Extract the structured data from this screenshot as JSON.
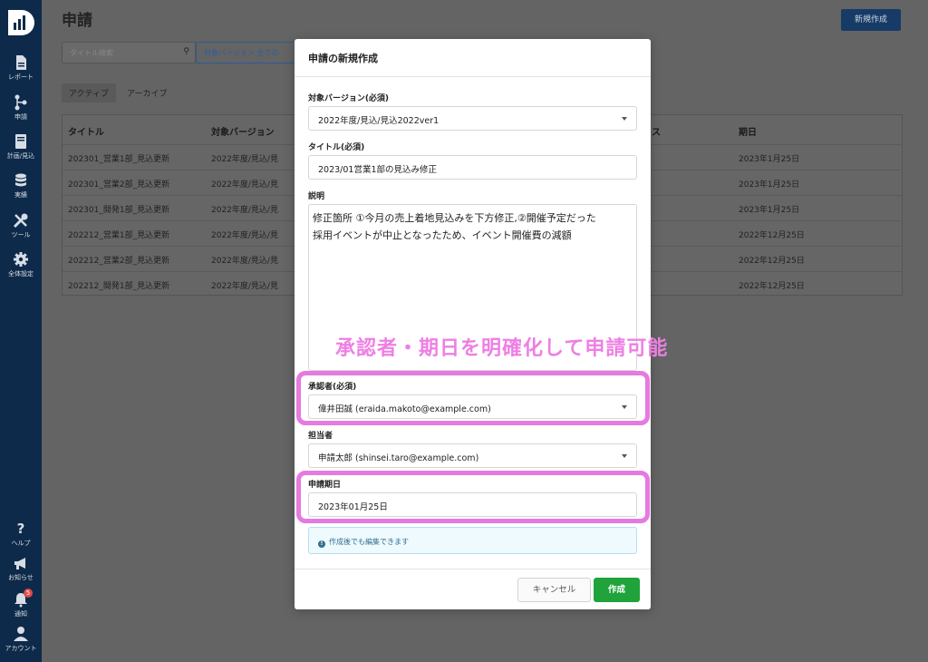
{
  "sidebar": {
    "items": [
      {
        "label": "レポート",
        "icon": "file-icon"
      },
      {
        "label": "申請",
        "icon": "flow-icon"
      },
      {
        "label": "計画/見込",
        "icon": "book-icon"
      },
      {
        "label": "実績",
        "icon": "database-icon"
      },
      {
        "label": "ツール",
        "icon": "tools-icon"
      },
      {
        "label": "全体設定",
        "icon": "gear-icon"
      }
    ],
    "bottom": [
      {
        "label": "ヘルプ",
        "icon": "help-icon"
      },
      {
        "label": "お知らせ",
        "icon": "megaphone-icon"
      },
      {
        "label": "通知",
        "icon": "bell-icon",
        "badge": "5"
      },
      {
        "label": "アカウント",
        "icon": "user-icon"
      }
    ]
  },
  "page": {
    "title": "申請",
    "new_button": "新規作成",
    "search_placeholder": "タイトル検索",
    "filter_label": "対象バージョン 全ての",
    "tabs": [
      "アクティブ",
      "アーカイブ"
    ]
  },
  "table": {
    "headers": [
      "タイトル",
      "対象バージョン",
      "ス",
      "期日"
    ],
    "rows": [
      [
        "202301_営業1部_見込更新",
        "2022年度/見込/見",
        "2023年1月25日"
      ],
      [
        "202301_営業2部_見込更新",
        "2022年度/見込/見",
        "2023年1月25日"
      ],
      [
        "202301_開発1部_見込更新",
        "2022年度/見込/見",
        "2023年1月25日"
      ],
      [
        "202212_営業1部_見込更新",
        "2022年度/見込/見",
        "2022年12月25日"
      ],
      [
        "202212_営業2部_見込更新",
        "2022年度/見込/見",
        "2022年12月25日"
      ],
      [
        "202212_開発1部_見込更新",
        "2022年度/見込/見",
        "2022年12月25日"
      ]
    ]
  },
  "modal": {
    "title": "申請の新規作成",
    "version_label": "対象バージョン(必須)",
    "version_value": "2022年度/見込/見込2022ver1",
    "title_label": "タイトル(必須)",
    "title_value": "2023/01営業1部の見込み修正",
    "desc_label": "説明",
    "desc_line1": "修正箇所 ①今月の売上着地見込みを下方修正,②開催予定だった",
    "desc_line2": "採用イベントが中止となったため、イベント開催費の減額",
    "approver_label": "承認者(必須)",
    "approver_value": "偉井田誠 (eraida.makoto@example.com)",
    "assignee_label": "担当者",
    "assignee_value": "申請太郎 (shinsei.taro@example.com)",
    "due_label": "申請期日",
    "due_value": "2023年01月25日",
    "info_text": "作成後でも編集できます",
    "cancel": "キャンセル",
    "create": "作成"
  },
  "annotation": {
    "callout": "承認者・期日を明確化して申請可能",
    "color": "#e57ae0"
  },
  "colors": {
    "sidebar": "#0e2a4a",
    "create_button": "#1fa33a",
    "info_bg": "#eefafd"
  }
}
